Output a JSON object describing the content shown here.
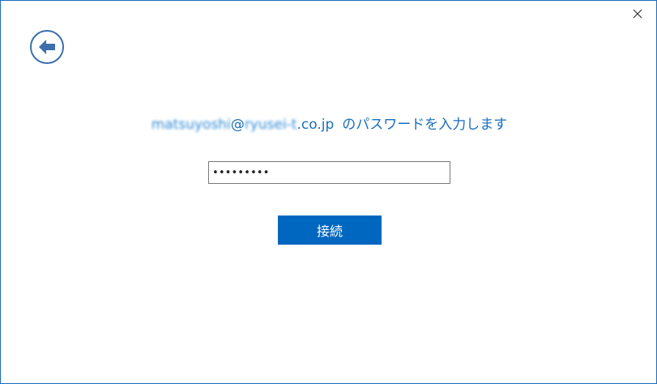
{
  "dialog": {
    "close_icon": "close-icon",
    "back_icon": "back-arrow-icon"
  },
  "prompt": {
    "email_user": "matsuyoshi",
    "email_at": "@",
    "email_domain_blurred": "ryusei-t",
    "email_suffix": ".co.jp",
    "text": "のパスワードを入力します"
  },
  "password": {
    "value": "•••••••••"
  },
  "connect_button": {
    "label": "接続"
  },
  "colors": {
    "accent": "#0067c0",
    "prompt_text": "#1a6fbf",
    "back_icon": "#3b6fae"
  }
}
